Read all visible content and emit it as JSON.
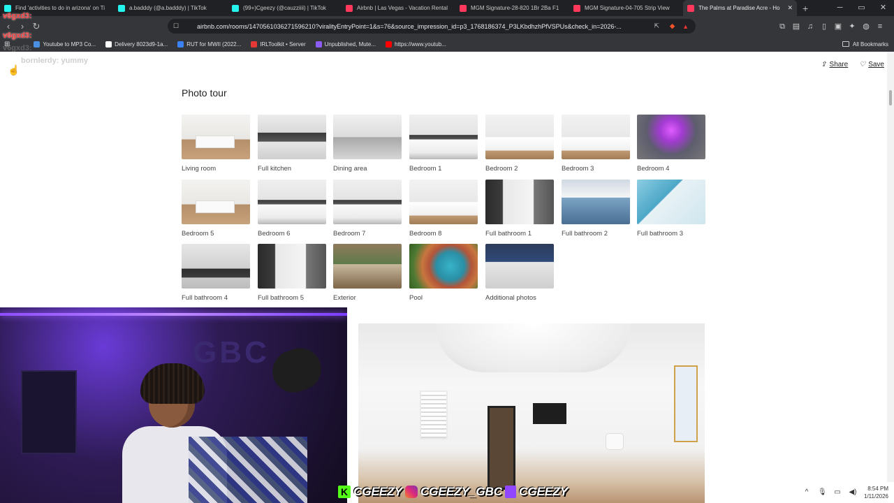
{
  "browser": {
    "tabs": [
      {
        "label": "Find 'activities to do in arizona' on Ti",
        "icon_color": "#25f4ee",
        "icon": "tiktok-icon",
        "active": false
      },
      {
        "label": "a.badddy (@a.badddy) | TikTok",
        "icon_color": "#25f4ee",
        "icon": "tiktok-icon",
        "active": false
      },
      {
        "label": "(99+)Cgeezy (@cauzziiii) | TikTok",
        "icon_color": "#25f4ee",
        "icon": "tiktok-icon",
        "active": false
      },
      {
        "label": "Airbnb | Las Vegas - Vacation Rental",
        "icon_color": "#ff385c",
        "icon": "airbnb-icon",
        "active": false
      },
      {
        "label": "MGM Signature-28-820 1Br 2Ba F1",
        "icon_color": "#ff385c",
        "icon": "airbnb-icon",
        "active": false
      },
      {
        "label": "MGM Signature-04-705 Strip View",
        "icon_color": "#ff385c",
        "icon": "airbnb-icon",
        "active": false
      },
      {
        "label": "The Palms at Paradise Acre - Ho",
        "icon_color": "#ff385c",
        "icon": "airbnb-icon",
        "active": true
      }
    ],
    "new_tab": "+",
    "url": "airbnb.com/rooms/1470561036271596210?viralityEntryPoint=1&s=76&source_impression_id=p3_1768186374_P3LKbdhzhPfVSPUs&check_in=2026-..."
  },
  "bookmarks": [
    {
      "label": "Youtube to MP3 Co...",
      "color": "#4a90e2"
    },
    {
      "label": "Delivery 8023d9-1a...",
      "color": "#ffffff"
    },
    {
      "label": "RUT for MWII (2022...",
      "color": "#3b82f6"
    },
    {
      "label": "IRLToolkit • Server",
      "color": "#e53935"
    },
    {
      "label": "Unpublished, Mute...",
      "color": "#8b5cf6"
    },
    {
      "label": "https://www.youtub...",
      "color": "#ff0000"
    }
  ],
  "all_bookmarks": "All Bookmarks",
  "page": {
    "share": "Share",
    "save": "Save",
    "heading": "Photo tour",
    "tiles": [
      {
        "caption": "Living room",
        "style": "room"
      },
      {
        "caption": "Full kitchen",
        "style": "kitchen"
      },
      {
        "caption": "Dining area",
        "style": "dining"
      },
      {
        "caption": "Bedroom 1",
        "style": "bed"
      },
      {
        "caption": "Bedroom 2",
        "style": "bedwood"
      },
      {
        "caption": "Bedroom 3",
        "style": "bedwood"
      },
      {
        "caption": "Bedroom 4",
        "style": "bedpurple"
      },
      {
        "caption": "Bedroom 5",
        "style": "room"
      },
      {
        "caption": "Bedroom 6",
        "style": "bed"
      },
      {
        "caption": "Bedroom 7",
        "style": "bed"
      },
      {
        "caption": "Bedroom 8",
        "style": "bedwood"
      },
      {
        "caption": "Full bathroom 1",
        "style": "bath"
      },
      {
        "caption": "Full bathroom 2",
        "style": "bath2"
      },
      {
        "caption": "Full bathroom 3",
        "style": "bath3"
      },
      {
        "caption": "Full bathroom 4",
        "style": "bath4"
      },
      {
        "caption": "Full bathroom 5",
        "style": "bath"
      },
      {
        "caption": "Exterior",
        "style": "exterior"
      },
      {
        "caption": "Pool",
        "style": "pool"
      },
      {
        "caption": "Additional photos",
        "style": "addl"
      }
    ]
  },
  "chat": {
    "user1": "v6gxd3:",
    "user2": "v6gxd3:",
    "user3": "v6gxd3:",
    "msg_user": "bornlerdy:",
    "msg_text": "yummy"
  },
  "stream": {
    "sign": "GBC",
    "handle1": "CGEEZY",
    "handle2": "CGEEZY_GBC",
    "handle3": "CGEEZY",
    "kick_letter": "K"
  },
  "tray": {
    "time": "8:54 PM",
    "date": "1/11/2026"
  }
}
